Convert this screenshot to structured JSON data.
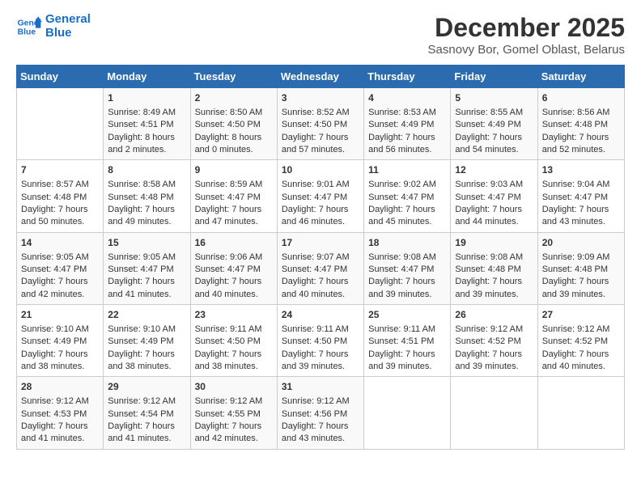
{
  "header": {
    "logo_line1": "General",
    "logo_line2": "Blue",
    "month_title": "December 2025",
    "location": "Sasnovy Bor, Gomel Oblast, Belarus"
  },
  "days_of_week": [
    "Sunday",
    "Monday",
    "Tuesday",
    "Wednesday",
    "Thursday",
    "Friday",
    "Saturday"
  ],
  "weeks": [
    [
      {
        "day": "",
        "content": ""
      },
      {
        "day": "1",
        "content": "Sunrise: 8:49 AM\nSunset: 4:51 PM\nDaylight: 8 hours\nand 2 minutes."
      },
      {
        "day": "2",
        "content": "Sunrise: 8:50 AM\nSunset: 4:50 PM\nDaylight: 8 hours\nand 0 minutes."
      },
      {
        "day": "3",
        "content": "Sunrise: 8:52 AM\nSunset: 4:50 PM\nDaylight: 7 hours\nand 57 minutes."
      },
      {
        "day": "4",
        "content": "Sunrise: 8:53 AM\nSunset: 4:49 PM\nDaylight: 7 hours\nand 56 minutes."
      },
      {
        "day": "5",
        "content": "Sunrise: 8:55 AM\nSunset: 4:49 PM\nDaylight: 7 hours\nand 54 minutes."
      },
      {
        "day": "6",
        "content": "Sunrise: 8:56 AM\nSunset: 4:48 PM\nDaylight: 7 hours\nand 52 minutes."
      }
    ],
    [
      {
        "day": "7",
        "content": "Sunrise: 8:57 AM\nSunset: 4:48 PM\nDaylight: 7 hours\nand 50 minutes."
      },
      {
        "day": "8",
        "content": "Sunrise: 8:58 AM\nSunset: 4:48 PM\nDaylight: 7 hours\nand 49 minutes."
      },
      {
        "day": "9",
        "content": "Sunrise: 8:59 AM\nSunset: 4:47 PM\nDaylight: 7 hours\nand 47 minutes."
      },
      {
        "day": "10",
        "content": "Sunrise: 9:01 AM\nSunset: 4:47 PM\nDaylight: 7 hours\nand 46 minutes."
      },
      {
        "day": "11",
        "content": "Sunrise: 9:02 AM\nSunset: 4:47 PM\nDaylight: 7 hours\nand 45 minutes."
      },
      {
        "day": "12",
        "content": "Sunrise: 9:03 AM\nSunset: 4:47 PM\nDaylight: 7 hours\nand 44 minutes."
      },
      {
        "day": "13",
        "content": "Sunrise: 9:04 AM\nSunset: 4:47 PM\nDaylight: 7 hours\nand 43 minutes."
      }
    ],
    [
      {
        "day": "14",
        "content": "Sunrise: 9:05 AM\nSunset: 4:47 PM\nDaylight: 7 hours\nand 42 minutes."
      },
      {
        "day": "15",
        "content": "Sunrise: 9:05 AM\nSunset: 4:47 PM\nDaylight: 7 hours\nand 41 minutes."
      },
      {
        "day": "16",
        "content": "Sunrise: 9:06 AM\nSunset: 4:47 PM\nDaylight: 7 hours\nand 40 minutes."
      },
      {
        "day": "17",
        "content": "Sunrise: 9:07 AM\nSunset: 4:47 PM\nDaylight: 7 hours\nand 40 minutes."
      },
      {
        "day": "18",
        "content": "Sunrise: 9:08 AM\nSunset: 4:47 PM\nDaylight: 7 hours\nand 39 minutes."
      },
      {
        "day": "19",
        "content": "Sunrise: 9:08 AM\nSunset: 4:48 PM\nDaylight: 7 hours\nand 39 minutes."
      },
      {
        "day": "20",
        "content": "Sunrise: 9:09 AM\nSunset: 4:48 PM\nDaylight: 7 hours\nand 39 minutes."
      }
    ],
    [
      {
        "day": "21",
        "content": "Sunrise: 9:10 AM\nSunset: 4:49 PM\nDaylight: 7 hours\nand 38 minutes."
      },
      {
        "day": "22",
        "content": "Sunrise: 9:10 AM\nSunset: 4:49 PM\nDaylight: 7 hours\nand 38 minutes."
      },
      {
        "day": "23",
        "content": "Sunrise: 9:11 AM\nSunset: 4:50 PM\nDaylight: 7 hours\nand 38 minutes."
      },
      {
        "day": "24",
        "content": "Sunrise: 9:11 AM\nSunset: 4:50 PM\nDaylight: 7 hours\nand 39 minutes."
      },
      {
        "day": "25",
        "content": "Sunrise: 9:11 AM\nSunset: 4:51 PM\nDaylight: 7 hours\nand 39 minutes."
      },
      {
        "day": "26",
        "content": "Sunrise: 9:12 AM\nSunset: 4:52 PM\nDaylight: 7 hours\nand 39 minutes."
      },
      {
        "day": "27",
        "content": "Sunrise: 9:12 AM\nSunset: 4:52 PM\nDaylight: 7 hours\nand 40 minutes."
      }
    ],
    [
      {
        "day": "28",
        "content": "Sunrise: 9:12 AM\nSunset: 4:53 PM\nDaylight: 7 hours\nand 41 minutes."
      },
      {
        "day": "29",
        "content": "Sunrise: 9:12 AM\nSunset: 4:54 PM\nDaylight: 7 hours\nand 41 minutes."
      },
      {
        "day": "30",
        "content": "Sunrise: 9:12 AM\nSunset: 4:55 PM\nDaylight: 7 hours\nand 42 minutes."
      },
      {
        "day": "31",
        "content": "Sunrise: 9:12 AM\nSunset: 4:56 PM\nDaylight: 7 hours\nand 43 minutes."
      },
      {
        "day": "",
        "content": ""
      },
      {
        "day": "",
        "content": ""
      },
      {
        "day": "",
        "content": ""
      }
    ]
  ]
}
